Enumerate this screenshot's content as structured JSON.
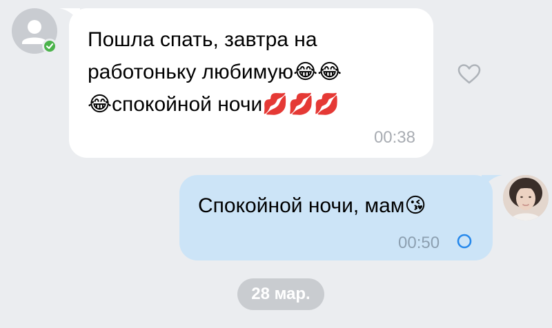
{
  "chat": {
    "incoming": {
      "text": "Пошла спать, завтра на\nработоньку любимую😂😂\n😂спокойной ночи💋💋💋",
      "time": "00:38",
      "sender_online": true
    },
    "outgoing": {
      "text": "Спокойной ночи, мам😘",
      "time": "00:50",
      "status": "sending"
    },
    "date_separator": "28 мар."
  },
  "icons": {
    "avatar_placeholder": "person-placeholder-icon",
    "online": "online-check-icon",
    "like": "heart-outline-icon",
    "status": "sending-ring-icon"
  },
  "colors": {
    "background": "#ebedf0",
    "incoming_bubble": "#ffffff",
    "outgoing_bubble": "#cce4f7",
    "online_green": "#4bb34b",
    "status_blue": "#2688eb",
    "timestamp_gray": "#a8acb2",
    "date_pill": "#c9ccd0"
  }
}
